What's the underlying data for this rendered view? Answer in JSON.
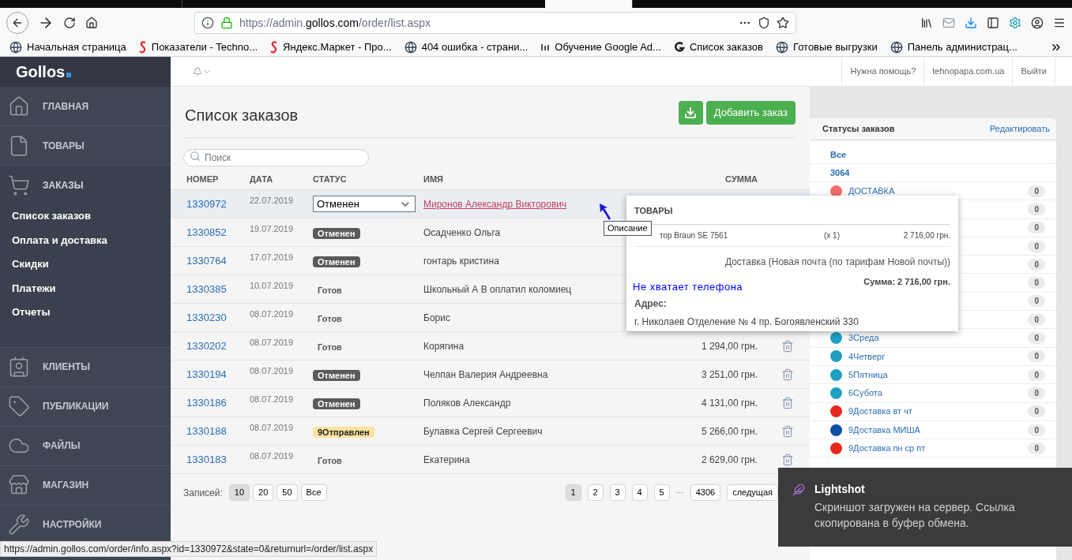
{
  "browser": {
    "url_prefix": "https://admin.",
    "url_domain": "gollos.com",
    "url_path": "/order/list.aspx",
    "bookmarks": [
      {
        "label": "Начальная страница",
        "kind": "globe"
      },
      {
        "label": "Показатели - Techno...",
        "kind": "s"
      },
      {
        "label": "Яндекс.Маркет - Про...",
        "kind": "s"
      },
      {
        "label": "404 ошибка - страни...",
        "kind": "globe"
      },
      {
        "label": "Обучение Google Ad...",
        "kind": "small"
      },
      {
        "label": "Список заказов",
        "kind": "g"
      },
      {
        "label": "Готовые выгрузки",
        "kind": "globe"
      },
      {
        "label": "Панель администрац...",
        "kind": "globe"
      }
    ]
  },
  "logo": "Gollos",
  "sidebar": {
    "items": [
      {
        "label": "ГЛАВНАЯ",
        "expanded": false
      },
      {
        "label": "ТОВАРЫ",
        "expanded": false
      },
      {
        "label": "ЗАКАЗЫ",
        "expanded": true,
        "children": [
          "Список заказов",
          "Оплата и доставка",
          "Скидки",
          "Платежи",
          "Отчеты"
        ]
      },
      {
        "label": "КЛИЕНТЫ",
        "expanded": false
      },
      {
        "label": "ПУБЛИКАЦИИ",
        "expanded": false
      },
      {
        "label": "ФАЙЛЫ",
        "expanded": false
      },
      {
        "label": "МАГАЗИН",
        "expanded": false
      },
      {
        "label": "НАСТРОЙКИ",
        "expanded": false
      }
    ]
  },
  "header": {
    "links": [
      "Нужна помощь?",
      "tehnopapa.com.ua",
      "Выйти"
    ]
  },
  "page": {
    "title": "Список заказов",
    "add_button": "Добавить заказ",
    "search": {
      "placeholder": "Поиск"
    }
  },
  "table": {
    "columns": [
      "НОМЕР",
      "ДАТА",
      "СТАТУС",
      "ИМЯ",
      "СУММА"
    ],
    "rows": [
      {
        "number": "1330972",
        "date": "22.07.2019",
        "status": {
          "kind": "select",
          "text": "Отменен"
        },
        "name": "Миронов Александр Викторович",
        "selected": true
      },
      {
        "number": "1330852",
        "date": "19.07.2019",
        "status": {
          "kind": "dark",
          "text": "Отменен"
        },
        "name": "Осадченко Ольга",
        "selected": false
      },
      {
        "number": "1330764",
        "date": "17.07.2019",
        "status": {
          "kind": "dark",
          "text": "Отменен"
        },
        "name": "гонтарь кристина",
        "selected": false
      },
      {
        "number": "1330385",
        "date": "10.07.2019",
        "status": {
          "kind": "plain",
          "text": "Готов"
        },
        "name": "Школьный А В оплатил коломиец",
        "selected": false
      },
      {
        "number": "1330230",
        "date": "08.07.2019",
        "status": {
          "kind": "plain",
          "text": "Готов"
        },
        "name": "Борис",
        "selected": false
      },
      {
        "number": "1330202",
        "date": "08.07.2019",
        "status": {
          "kind": "plain",
          "text": "Готов"
        },
        "name": "Корягина",
        "sum": "1 294,00 грн.",
        "selected": false
      },
      {
        "number": "1330194",
        "date": "08.07.2019",
        "status": {
          "kind": "dark",
          "text": "Отменен"
        },
        "name": "Челпан Валерия Андреевна",
        "sum": "3 251,00 грн.",
        "selected": false
      },
      {
        "number": "1330186",
        "date": "08.07.2019",
        "status": {
          "kind": "dark",
          "text": "Отменен"
        },
        "name": "Поляков Александр",
        "sum": "4 131,00 грн.",
        "selected": false
      },
      {
        "number": "1330188",
        "date": "08.07.2019",
        "status": {
          "kind": "yellow",
          "text": "9Отправлен"
        },
        "name": "Булавка Сергей Сергеевич",
        "sum": "5 266,00 грн.",
        "selected": false
      },
      {
        "number": "1330183",
        "date": "08.07.2019",
        "status": {
          "kind": "plain",
          "text": "Готов"
        },
        "name": "Екатерина",
        "sum": "2 629,00 грн.",
        "selected": false
      }
    ]
  },
  "per_page": {
    "label": "Записей:",
    "options": [
      {
        "label": "10",
        "selected": true
      },
      {
        "label": "20",
        "selected": false
      },
      {
        "label": "50",
        "selected": false
      },
      {
        "label": "Все",
        "selected": false
      }
    ]
  },
  "pagination": {
    "pages": [
      {
        "label": "1",
        "selected": true
      },
      {
        "label": "2",
        "selected": false
      },
      {
        "label": "3",
        "selected": false
      },
      {
        "label": "4",
        "selected": false
      },
      {
        "label": "5",
        "selected": false
      }
    ],
    "ellipsis": "···",
    "last": "4306",
    "next": "следущая"
  },
  "statuses": {
    "title": "Статусы заказов",
    "edit": "Редактировать",
    "links": [
      "Все",
      "3064"
    ],
    "items": [
      {
        "name": "ДОСТАВКА",
        "color": "#f26d6d",
        "count": "0"
      },
      {
        "count": "0"
      },
      {
        "count": "0"
      },
      {
        "count": "0"
      },
      {
        "count": "0"
      },
      {
        "count": "0"
      },
      {
        "count": "0"
      },
      {
        "count": "0"
      },
      {
        "name": "3Среда",
        "color": "#1fa0c2",
        "count": "0"
      },
      {
        "name": "4Четверг",
        "color": "#1fa0c2",
        "count": "0"
      },
      {
        "name": "5Пятница",
        "color": "#1fa0c2",
        "count": "0"
      },
      {
        "name": "6Субота",
        "color": "#1fa0c2",
        "count": "0"
      },
      {
        "name": "9Доставка вт чт",
        "color": "#e8281a",
        "count": "0"
      },
      {
        "name": "9Доставка МИША",
        "color": "#0b4ea2",
        "count": "0"
      },
      {
        "name": "9Доставка пн ср пт",
        "color": "#e8281a",
        "count": "0"
      }
    ]
  },
  "popover": {
    "title": "ТОВАРЫ",
    "product": "тор Braun SE 7561",
    "qty": "(x 1)",
    "price": "2 716,00 грн.",
    "delivery": "Доставка (Новая почта (по тарифам Новой почты))",
    "total": "Сумма: 2 716,00 грн.",
    "warning": "Не хватает телефона",
    "address_label": "Адрес:",
    "address": "г. Николаев Отделение № 4 пр. Богоявленский 330"
  },
  "tooltip": "Описание",
  "toast": {
    "title": "Lightshot",
    "message": "Скриншот загружен на сервер. Ссылка скопирована в буфер обмена."
  },
  "status_url": "https://admin.gollos.com/order/info.aspx?id=1330972&state=0&returnurl=/order/list.aspx"
}
